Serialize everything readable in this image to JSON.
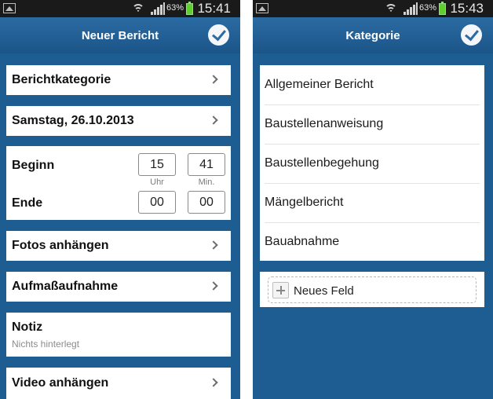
{
  "left_screen": {
    "status": {
      "battery_percent": "63%",
      "time": "15:41"
    },
    "title": "Neuer Bericht",
    "rows": {
      "category": "Berichtkategorie",
      "date": "Samstag, 26.10.2013",
      "begin_label": "Beginn",
      "end_label": "Ende",
      "begin_hour": "15",
      "begin_minute": "41",
      "end_hour": "00",
      "end_minute": "00",
      "hour_caption": "Uhr",
      "minute_caption": "Min.",
      "photos": "Fotos anhängen",
      "measurement": "Aufmaßaufnahme",
      "note_label": "Notiz",
      "note_value": "Nichts hinterlegt",
      "video": "Video anhängen"
    }
  },
  "right_screen": {
    "status": {
      "battery_percent": "63%",
      "time": "15:43"
    },
    "title": "Kategorie",
    "categories": [
      "Allgemeiner Bericht",
      "Baustellenanweisung",
      "Baustellenbegehung",
      "Mängelbericht",
      "Bauabnahme"
    ],
    "new_field_label": "Neues Feld"
  },
  "colors": {
    "app_background": "#1e5d92",
    "titlebar": "#2b6ba3",
    "statusbar": "#1a1a1a",
    "card": "#ffffff"
  },
  "icons": [
    "image-icon",
    "wifi-icon",
    "signal-icon",
    "battery-icon",
    "check-icon",
    "chevron-right-icon",
    "plus-icon"
  ]
}
